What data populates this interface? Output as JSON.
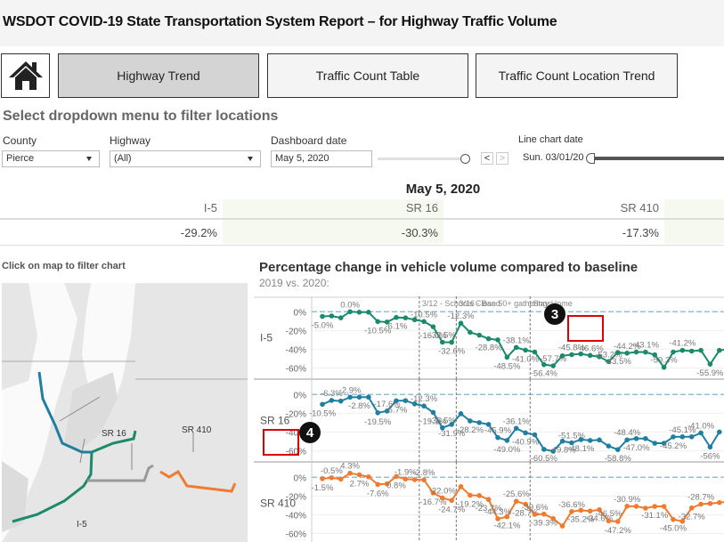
{
  "header": {
    "title": "WSDOT COVID-19 State Transportation System Report – for Highway Traffic Volume"
  },
  "nav": {
    "home_icon": "home-icon",
    "tabs": [
      {
        "label": "Highway Trend",
        "active": true
      },
      {
        "label": "Traffic Count Table",
        "active": false
      },
      {
        "label": "Traffic Count Location Trend",
        "active": false
      }
    ]
  },
  "filters": {
    "section_title": "Select dropdown menu to filter locations",
    "county": {
      "label": "County",
      "value": "Pierce"
    },
    "highway": {
      "label": "Highway",
      "value": "(All)"
    },
    "dashboard_date": {
      "label": "Dashboard date",
      "value": "May 5, 2020",
      "prev": "<",
      "next": ">"
    },
    "line_chart_date": {
      "label": "Line chart date",
      "value": "Sun. 03/01/20"
    }
  },
  "kpi": {
    "date": "May 5, 2020",
    "columns": [
      {
        "name": "I-5",
        "value": "-29.2%"
      },
      {
        "name": "SR 16",
        "value": "-30.3%"
      },
      {
        "name": "SR 410",
        "value": "-17.3%"
      }
    ]
  },
  "map": {
    "title": "Click on map to filter chart",
    "labels": {
      "sr16": "SR 16",
      "sr410": "SR 410",
      "i5": "I-5"
    }
  },
  "chart": {
    "title": "Percentage change in vehicle volume compared to baseline",
    "subtitle": "2019 vs. 2020:",
    "markers": {
      "three": "3",
      "four": "4"
    }
  },
  "chart_data": {
    "type": "line",
    "title": "Percentage change in vehicle volume compared to baseline",
    "subtitle": "2019 vs. 2020:",
    "ylabel": "",
    "yticks": [
      "0%",
      "-20%",
      "-40%",
      "-60%"
    ],
    "ylim": [
      -70,
      5
    ],
    "reference_lines": [
      {
        "label": "3/12 - Schools Closed",
        "day": 11
      },
      {
        "label": "3/16 - Ban 50+ gatherings",
        "day": 15
      },
      {
        "label": "Stay Home",
        "day": 23
      }
    ],
    "series": [
      {
        "name": "I-5",
        "color": "#1b8a6b",
        "values": [
          -5.0,
          -4.5,
          -6.5,
          0.0,
          -0.5,
          -0.5,
          -10.5,
          -11,
          -6.1,
          -6.5,
          -8.5,
          -10.5,
          -16.0,
          -32.5,
          -32.6,
          -12.3,
          -22,
          -25,
          -28.8,
          -30,
          -48.5,
          -38.1,
          -41.0,
          -43,
          -56.4,
          -57.7,
          -47,
          -45.8,
          -45,
          -46.6,
          -48,
          -53.2,
          -43.5,
          -44.2,
          -43,
          -43.1,
          -46,
          -59.3,
          -43,
          -41.2,
          -42,
          -41.2,
          -55.9,
          -41.2,
          -40
        ],
        "labels": [
          "-5.0%",
          "",
          "",
          "0.0%",
          "",
          "",
          "-10.5%",
          "",
          "-6.1%",
          "",
          "",
          "-10.5%",
          "-16.0%",
          "-32.5%",
          "-32.6%",
          "-12.3%",
          "",
          "",
          "-28.8%",
          "",
          "-48.5%",
          "-38.1%",
          "-41.0%",
          "",
          "-56.4%",
          "-57.7%",
          "",
          "-45.8%",
          "",
          "-46.6%",
          "",
          "-53.2%",
          "-43.5%",
          "-44.2%",
          "",
          "-43.1%",
          "",
          "-59.3%",
          "",
          "-41.2%",
          "",
          "",
          "-55.9%",
          "",
          ""
        ]
      },
      {
        "name": "SR 16",
        "color": "#1f7fa0",
        "values": [
          -10.5,
          -6.3,
          -7,
          -2.9,
          -2.8,
          -2.8,
          -19.5,
          -17.6,
          -6.7,
          -6.5,
          -10,
          -12.3,
          -19.1,
          -35.5,
          -31.9,
          -20.5,
          -28.2,
          -30,
          -31.9,
          -45.9,
          -49.0,
          -36.1,
          -40.9,
          -43,
          -58.5,
          -60.5,
          -49.8,
          -51.5,
          -48.1,
          -49,
          -48.5,
          -55,
          -58.8,
          -48.4,
          -47.0,
          -47,
          -52,
          -52,
          -45.2,
          -45.1,
          -45.1,
          -41.0,
          -56,
          -40
        ],
        "labels": [
          "-10.5%",
          "-6.3%",
          "",
          "-2.9%",
          "-2.8%",
          "",
          "-19.5%",
          "-17.6%",
          "-6.7%",
          "",
          "",
          "-12.3%",
          "-19.1%",
          "-35.5%",
          "-31.9%",
          "",
          "-28.2%",
          "",
          "",
          "-45.9%",
          "-49.0%",
          "-36.1%",
          "-40.9%",
          "",
          "-60.5%",
          "",
          "-49.8%",
          "-51.5%",
          "-48.1%",
          "",
          "",
          "",
          "-58.8%",
          "-48.4%",
          "-47.0%",
          "",
          "",
          "",
          "-45.2%",
          "-45.1%",
          "",
          "-41.0%",
          "-56%",
          ""
        ]
      },
      {
        "name": "SR 410",
        "color": "#f07a2e",
        "values": [
          -1.5,
          -0.5,
          -2,
          4.3,
          2.7,
          0.5,
          -7.6,
          -7,
          0.8,
          -1.9,
          -2.5,
          -2.8,
          -16.7,
          -22.0,
          -24.7,
          -10,
          -19.2,
          -19.5,
          -23.7,
          -44.3,
          -42.1,
          -25.6,
          -28.7,
          -39.6,
          -39.3,
          -44,
          -52,
          -36.6,
          -35.2,
          -36,
          -34.6,
          -46.5,
          -47.2,
          -30.9,
          -31,
          -33,
          -31.1,
          -31.1,
          -45.0,
          -47,
          -32.7,
          -28.7,
          -28,
          -27,
          -26
        ],
        "labels": [
          "-1.5%",
          "-0.5%",
          "",
          "4.3%",
          "2.7%",
          "",
          "-7.6%",
          "",
          "0.8%",
          "-1.9%",
          "",
          "-2.8%",
          "-16.7%",
          "-22.0%",
          "-24.7%",
          "",
          "-19.2%",
          "",
          "-23.7%",
          "-44.3%",
          "-42.1%",
          "-25.6%",
          "-28.7%",
          "-39.6%",
          "-39.3%",
          "",
          "",
          "-36.6%",
          "-35.2%",
          "",
          "-34.6%",
          "-46.5%",
          "-47.2%",
          "-30.9%",
          "",
          "",
          "-31.1%",
          "",
          "-45.0%",
          "",
          "-32.7%",
          "-28.7%",
          "",
          "",
          ""
        ]
      }
    ]
  }
}
